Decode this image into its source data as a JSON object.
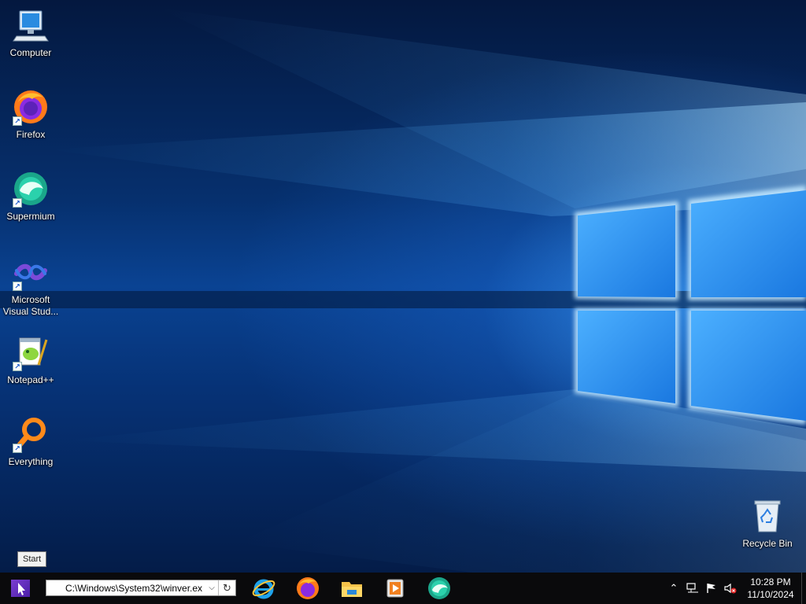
{
  "desktop": {
    "icons": [
      {
        "label": "Computer"
      },
      {
        "label": "Firefox"
      },
      {
        "label": "Supermium"
      },
      {
        "label": "Microsoft Visual Stud..."
      },
      {
        "label": "Notepad++"
      },
      {
        "label": "Everything"
      }
    ],
    "recycle_bin": {
      "label": "Recycle Bin"
    }
  },
  "tooltip": {
    "text": "Start"
  },
  "taskbar": {
    "address_value": "C:\\Windows\\System32\\winver.ex",
    "pinned": [
      {
        "icon": "internet-explorer-icon"
      },
      {
        "icon": "firefox-icon"
      },
      {
        "icon": "file-explorer-icon"
      },
      {
        "icon": "media-player-icon"
      },
      {
        "icon": "supermium-icon"
      }
    ],
    "tray": {
      "clock_time": "10:28 PM",
      "clock_date": "11/10/2024"
    }
  },
  "colors": {
    "taskbar_bg": "#0a0a0c",
    "wallpaper_accent": "#3aa2ff",
    "start_accent": "#6a32c8"
  }
}
